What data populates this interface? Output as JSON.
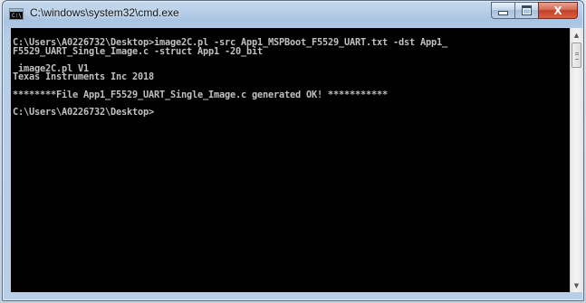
{
  "window": {
    "title": "C:\\windows\\system32\\cmd.exe",
    "icon": "cmd-console-icon",
    "icon_glyph": "C:\\"
  },
  "caption_buttons": {
    "minimize_icon": "minimize-icon",
    "maximize_icon": "maximize-icon",
    "close_icon": "close-icon",
    "close_glyph": "X"
  },
  "console": {
    "lines": [
      "C:\\Users\\A0226732\\Desktop>image2C.pl -src App1_MSPBoot_F5529_UART.txt -dst App1_",
      "F5529_UART_Single_Image.c -struct App1 -20_bit",
      "",
      " image2C.pl V1",
      "Texas Instruments Inc 2018",
      "",
      "********File App1_F5529_UART_Single_Image.c generated OK! ***********",
      "",
      "C:\\Users\\A0226732\\Desktop>"
    ]
  },
  "scrollbar": {
    "up_arrow": "▲",
    "down_arrow": "▼"
  },
  "colors": {
    "console_background": "#000000",
    "console_text": "#c0c0c0",
    "close_button": "#c2422a",
    "frame": "#b6cde6"
  }
}
